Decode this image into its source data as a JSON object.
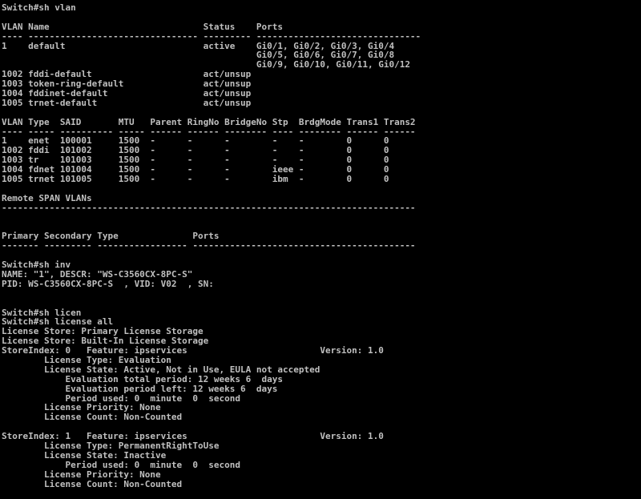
{
  "terminal": {
    "lines": [
      "Switch#sh vlan",
      "",
      "VLAN Name                             Status    Ports",
      "---- -------------------------------- --------- -------------------------------",
      "1    default                          active    Gi0/1, Gi0/2, Gi0/3, Gi0/4",
      "                                                Gi0/5, Gi0/6, Gi0/7, Gi0/8",
      "                                                Gi0/9, Gi0/10, Gi0/11, Gi0/12",
      "1002 fddi-default                     act/unsup",
      "1003 token-ring-default               act/unsup",
      "1004 fddinet-default                  act/unsup",
      "1005 trnet-default                    act/unsup",
      "",
      "VLAN Type  SAID       MTU   Parent RingNo BridgeNo Stp  BrdgMode Trans1 Trans2",
      "---- ----- ---------- ----- ------ ------ -------- ---- -------- ------ ------",
      "1    enet  100001     1500  -      -      -        -    -        0      0",
      "1002 fddi  101002     1500  -      -      -        -    -        0      0",
      "1003 tr    101003     1500  -      -      -        -    -        0      0",
      "1004 fdnet 101004     1500  -      -      -        ieee -        0      0",
      "1005 trnet 101005     1500  -      -      -        ibm  -        0      0",
      "",
      "Remote SPAN VLANs",
      "------------------------------------------------------------------------------",
      "",
      "",
      "Primary Secondary Type              Ports",
      "------- --------- ----------------- ------------------------------------------",
      "",
      "Switch#sh inv",
      "NAME: \"1\", DESCR: \"WS-C3560CX-8PC-S\"",
      "PID: WS-C3560CX-8PC-S  , VID: V02  , SN:",
      "",
      "",
      "Switch#sh licen",
      "Switch#sh license all",
      "License Store: Primary License Storage",
      "License Store: Built-In License Storage",
      "StoreIndex: 0   Feature: ipservices                         Version: 1.0",
      "        License Type: Evaluation",
      "        License State: Active, Not in Use, EULA not accepted",
      "            Evaluation total period: 12 weeks 6  days",
      "            Evaluation period left: 12 weeks 6  days",
      "            Period used: 0  minute  0  second",
      "        License Priority: None",
      "        License Count: Non-Counted",
      "",
      "StoreIndex: 1   Feature: ipservices                         Version: 1.0",
      "        License Type: PermanentRightToUse",
      "        License State: Inactive",
      "            Period used: 0  minute  0  second",
      "        License Priority: None",
      "        License Count: Non-Counted"
    ]
  }
}
